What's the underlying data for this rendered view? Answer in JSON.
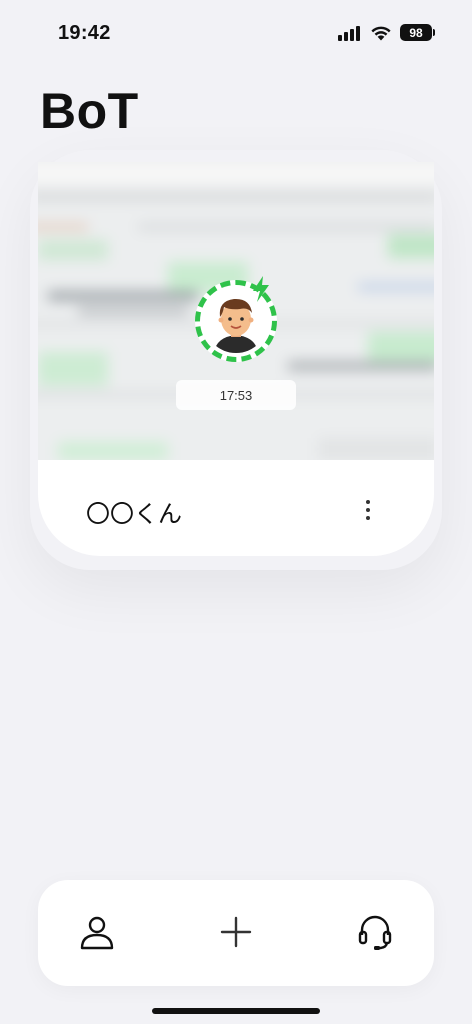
{
  "status_bar": {
    "time": "19:42",
    "battery": "98",
    "icons": [
      "signal-icon",
      "wifi-icon",
      "battery-icon"
    ]
  },
  "header": {
    "title": "BoT"
  },
  "card": {
    "timestamp": "17:53",
    "name": "〇〇くん",
    "avatar_icon": "boy-avatar-icon",
    "status_icon": "lightning-bolt-icon",
    "menu_icon": "more-vertical-icon",
    "accent_color": "#2fc24a"
  },
  "bottom_nav": {
    "items": [
      {
        "icon": "person-icon"
      },
      {
        "icon": "plus-icon"
      },
      {
        "icon": "headset-icon"
      }
    ]
  }
}
